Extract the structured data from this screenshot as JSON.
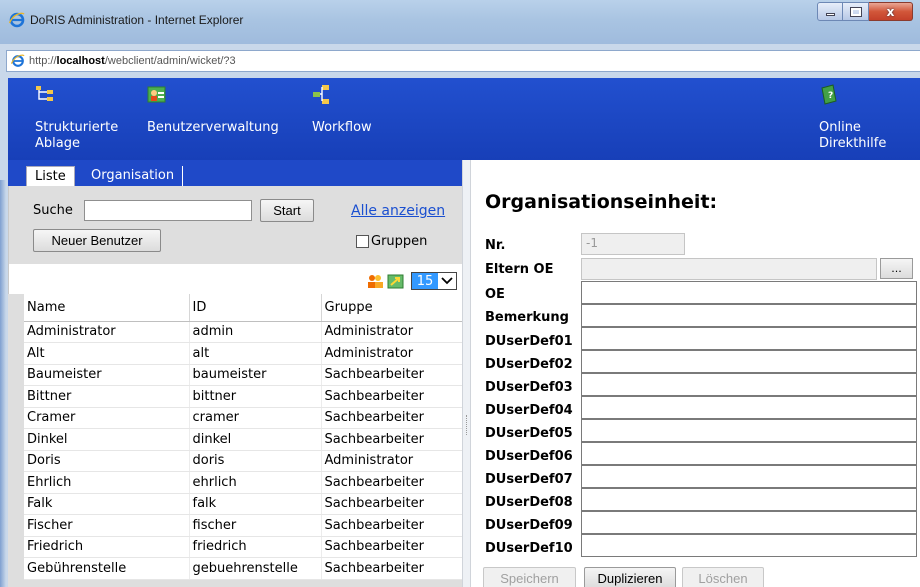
{
  "window": {
    "title": "DoRIS Administration - Internet Explorer",
    "min_glyph": "",
    "close_glyph": "x"
  },
  "address": {
    "url_prefix": "http://",
    "url_host": "localhost",
    "url_path": "/webclient/admin/wicket/?3"
  },
  "nav": {
    "items": [
      {
        "label": "Strukturierte Ablage",
        "icon": "structure-tree-icon"
      },
      {
        "label": "Benutzerverwaltung",
        "icon": "user-management-icon"
      },
      {
        "label": "Workflow",
        "icon": "workflow-icon"
      },
      {
        "label": "Online Direkthilfe",
        "icon": "help-book-icon"
      }
    ]
  },
  "left": {
    "tabs": [
      {
        "label": "Liste",
        "active": true
      },
      {
        "label": "Organisation",
        "active": false
      }
    ],
    "search_label": "Suche",
    "search_value": "",
    "start_button": "Start",
    "show_all_link": "Alle anzeigen",
    "new_user_button": "Neuer Benutzer",
    "groups_checkbox_label": "Gruppen",
    "groups_checked": false,
    "page_size": "15",
    "columns": [
      "Name",
      "ID",
      "Gruppe"
    ],
    "rows": [
      [
        "Administrator",
        "admin",
        "Administrator"
      ],
      [
        "Alt",
        "alt",
        "Administrator"
      ],
      [
        "Baumeister",
        "baumeister",
        "Sachbearbeiter"
      ],
      [
        "Bittner",
        "bittner",
        "Sachbearbeiter"
      ],
      [
        "Cramer",
        "cramer",
        "Sachbearbeiter"
      ],
      [
        "Dinkel",
        "dinkel",
        "Sachbearbeiter"
      ],
      [
        "Doris",
        "doris",
        "Administrator"
      ],
      [
        "Ehrlich",
        "ehrlich",
        "Sachbearbeiter"
      ],
      [
        "Falk",
        "falk",
        "Sachbearbeiter"
      ],
      [
        "Fischer",
        "fischer",
        "Sachbearbeiter"
      ],
      [
        "Friedrich",
        "friedrich",
        "Sachbearbeiter"
      ],
      [
        "Gebührenstelle",
        "gebuehrenstelle",
        "Sachbearbeiter"
      ]
    ]
  },
  "right": {
    "title": "Organisationseinheit:",
    "fields": {
      "nr": {
        "label": "Nr.",
        "value": "-1"
      },
      "eltern_oe": {
        "label": "Eltern OE",
        "value": "",
        "button": "..."
      },
      "oe": {
        "label": "OE",
        "value": ""
      },
      "bemerkung": {
        "label": "Bemerkung",
        "value": ""
      },
      "duserdef01": {
        "label": "DUserDef01",
        "value": ""
      },
      "duserdef02": {
        "label": "DUserDef02",
        "value": ""
      },
      "duserdef03": {
        "label": "DUserDef03",
        "value": ""
      },
      "duserdef04": {
        "label": "DUserDef04",
        "value": ""
      },
      "duserdef05": {
        "label": "DUserDef05",
        "value": ""
      },
      "duserdef06": {
        "label": "DUserDef06",
        "value": ""
      },
      "duserdef07": {
        "label": "DUserDef07",
        "value": ""
      },
      "duserdef08": {
        "label": "DUserDef08",
        "value": ""
      },
      "duserdef09": {
        "label": "DUserDef09",
        "value": ""
      },
      "duserdef10": {
        "label": "DUserDef10",
        "value": ""
      }
    },
    "buttons": {
      "save": "Speichern",
      "duplicate": "Duplizieren",
      "delete": "Löschen"
    }
  }
}
